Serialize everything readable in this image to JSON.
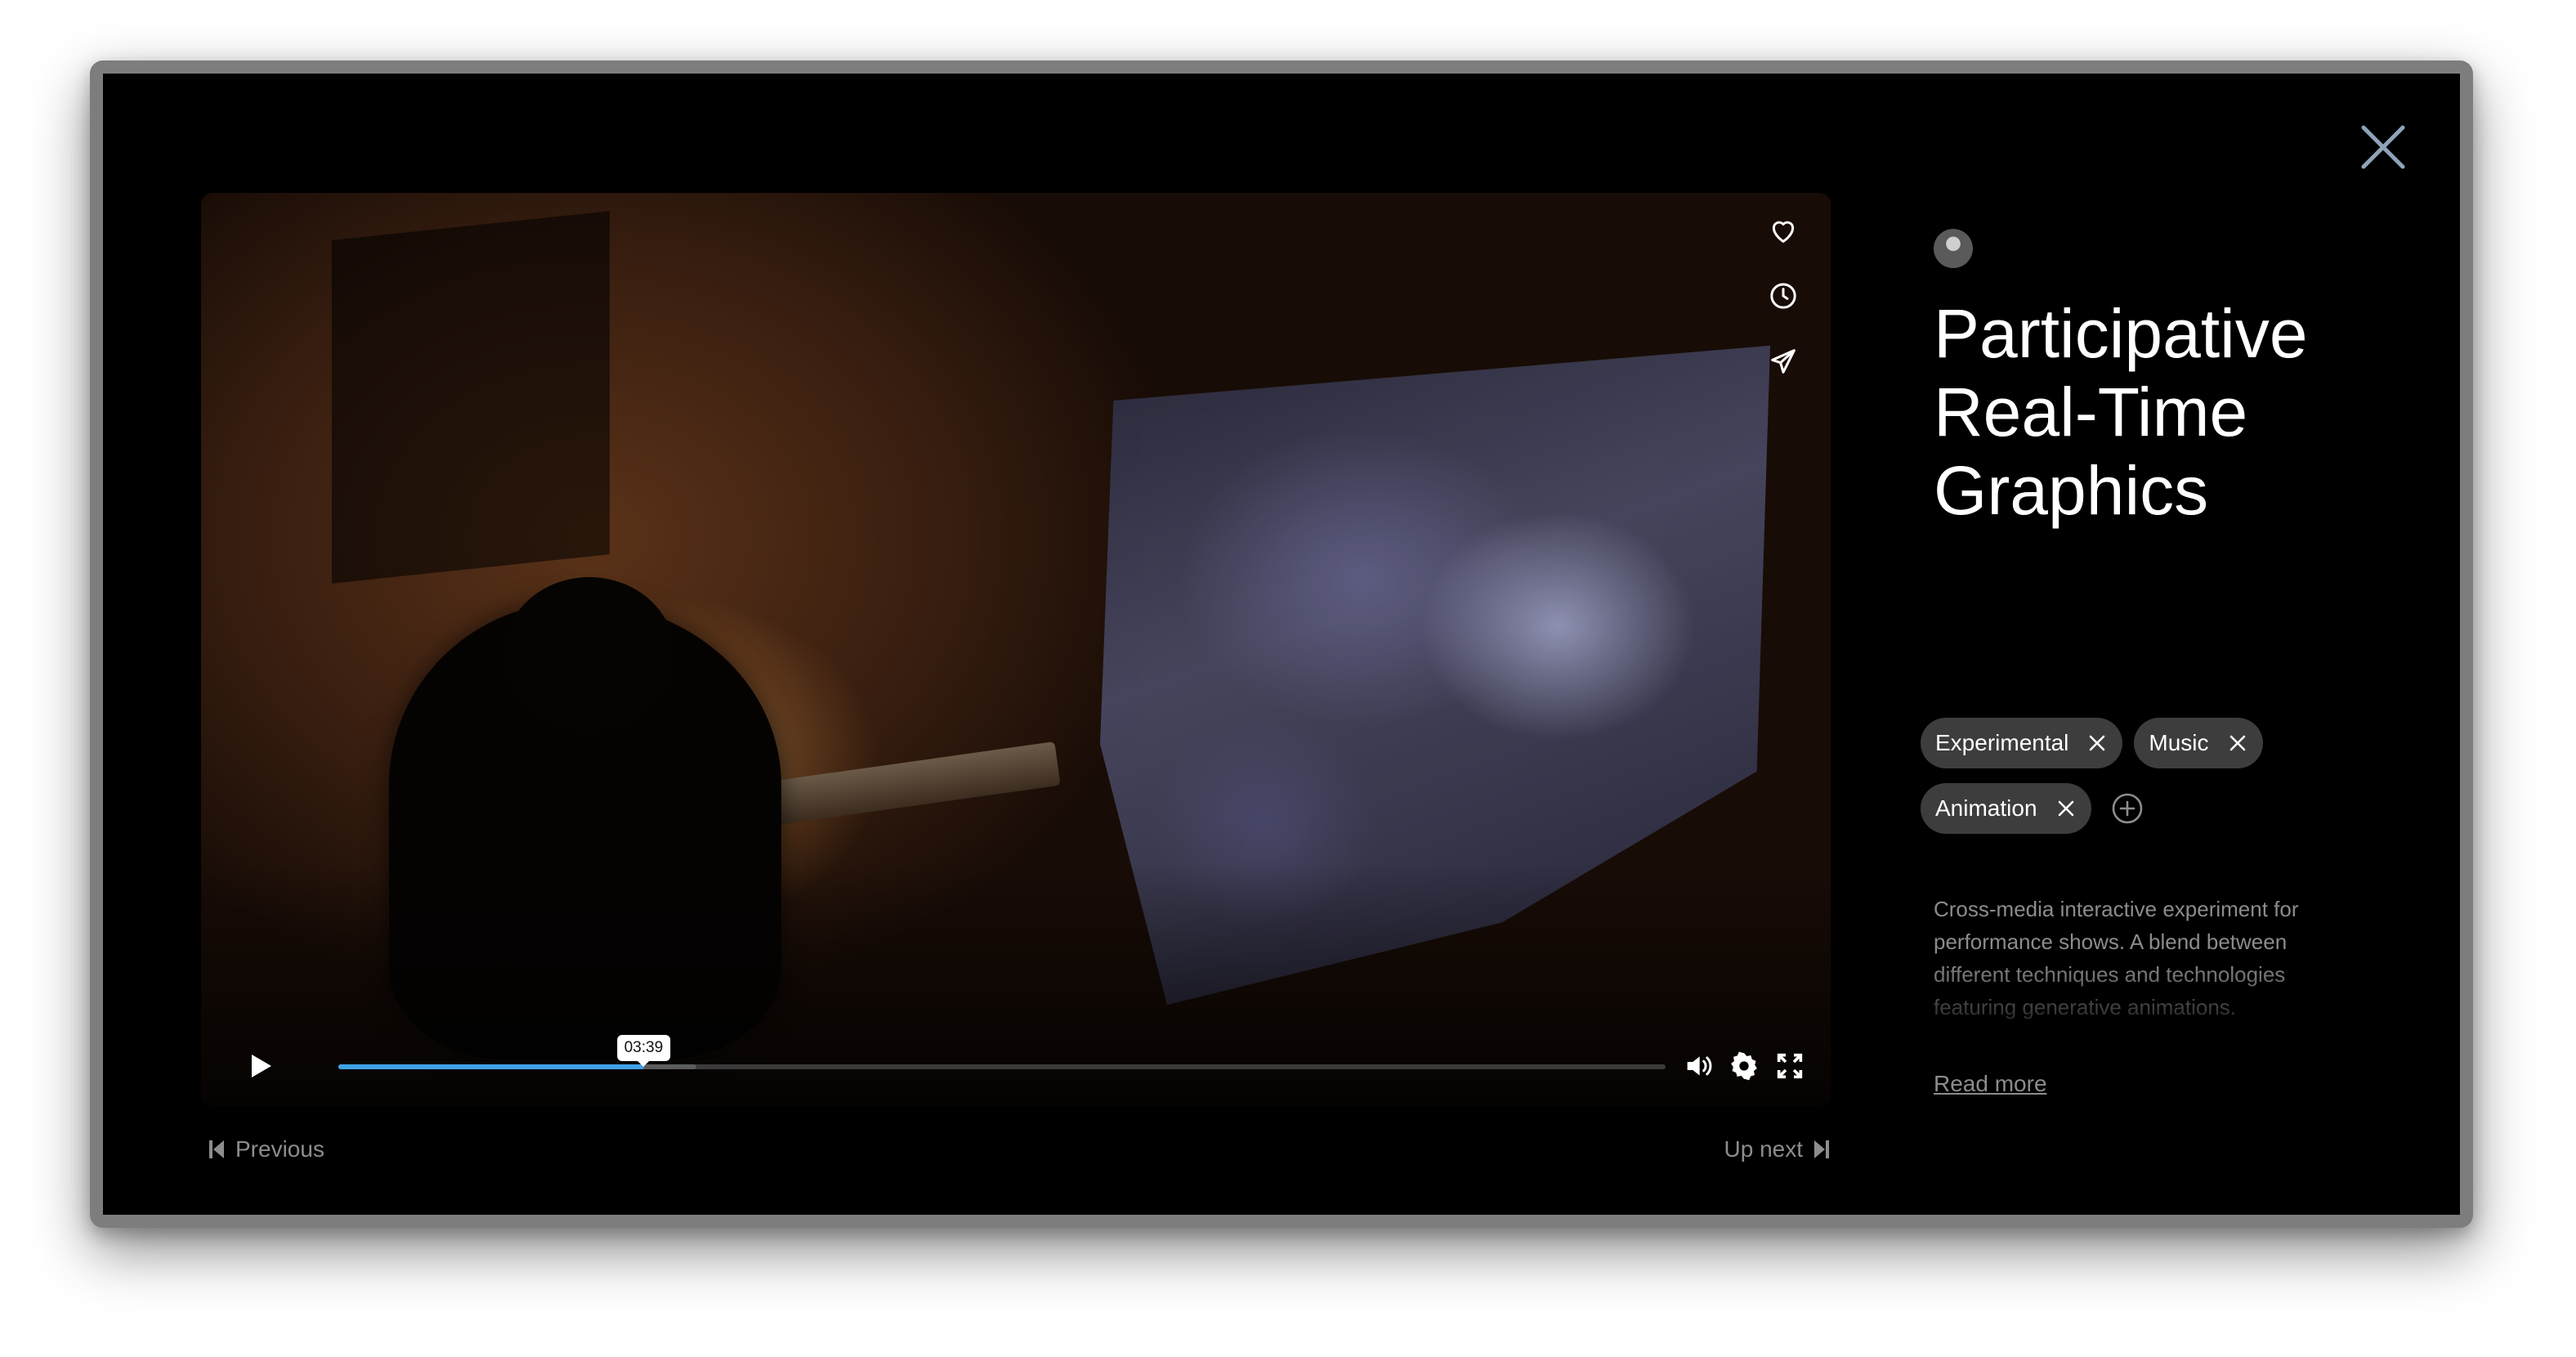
{
  "modal": {
    "close_icon": "close-icon",
    "accent_color": "#41a2e6"
  },
  "video": {
    "actions": [
      {
        "name": "like",
        "icon": "heart-icon"
      },
      {
        "name": "watch-later",
        "icon": "clock-icon"
      },
      {
        "name": "share",
        "icon": "send-icon"
      }
    ],
    "controls": {
      "play_icon": "play-icon",
      "current_time": "03:39",
      "progress_percent": 23,
      "buffered_percent": 27,
      "volume_icon": "volume-icon",
      "settings_icon": "gear-icon",
      "fullscreen_icon": "fullscreen-icon"
    }
  },
  "navigation": {
    "previous_label": "Previous",
    "next_label": "Up next"
  },
  "details": {
    "title_lines": [
      "Participative",
      "Real-Time",
      "Graphics"
    ],
    "tags": [
      "Experimental",
      "Music",
      "Animation"
    ],
    "description": "Cross-media interactive experiment for performance shows. A blend between different techniques and technologies featuring generative animations.",
    "read_more_label": "Read more"
  }
}
